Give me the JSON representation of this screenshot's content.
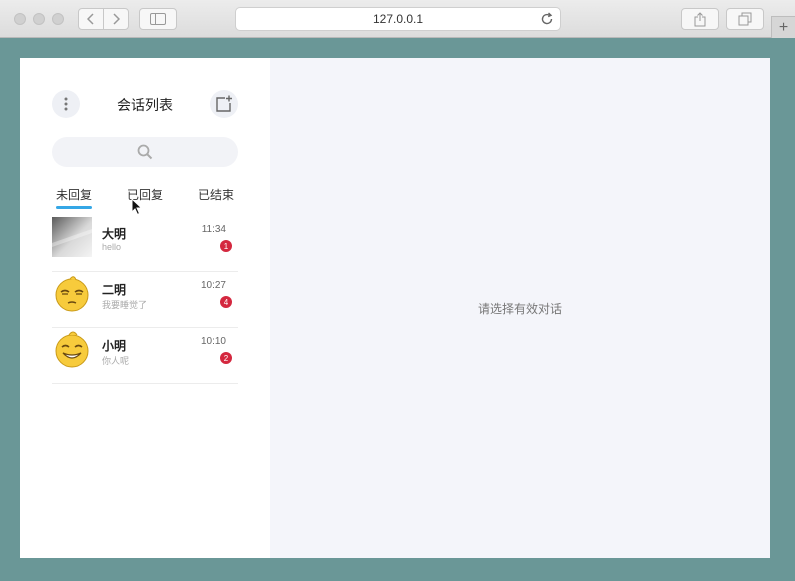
{
  "browser": {
    "url": "127.0.0.1",
    "new_tab_label": "+"
  },
  "sidebar": {
    "title": "会话列表",
    "tabs": [
      {
        "label": "未回复",
        "active": true
      },
      {
        "label": "已回复",
        "active": false
      },
      {
        "label": "已结束",
        "active": false
      }
    ],
    "conversations": [
      {
        "name": "大明",
        "message": "hello",
        "time": "11:34",
        "unread": "1",
        "avatar": "gradient-photo"
      },
      {
        "name": "二明",
        "message": "我要睡觉了",
        "time": "10:27",
        "unread": "4",
        "avatar": "sleepy-emoji"
      },
      {
        "name": "小明",
        "message": "你人呢",
        "time": "10:10",
        "unread": "2",
        "avatar": "grinning-emoji"
      }
    ]
  },
  "main": {
    "placeholder": "请选择有效对话"
  },
  "icons": {
    "more": "more-vertical-icon",
    "new_chat": "new-chat-icon",
    "search": "search-icon"
  },
  "colors": {
    "desktop": "#6a9797",
    "tab_active": "#35a7e6",
    "badge": "#d4283f",
    "main_bg": "#f4f5fa"
  }
}
